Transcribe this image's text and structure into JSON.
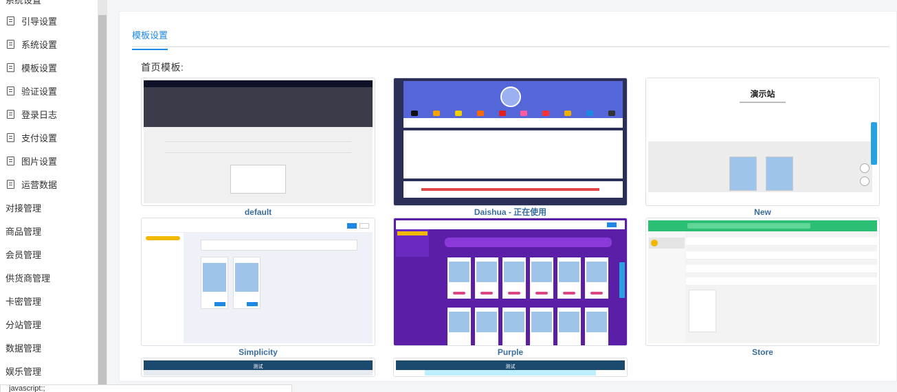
{
  "sidebar": {
    "header_fragment": "系统设置",
    "sub_items": [
      {
        "label": "引导设置",
        "icon": "document-icon"
      },
      {
        "label": "系统设置",
        "icon": "document-icon"
      },
      {
        "label": "模板设置",
        "icon": "document-icon"
      },
      {
        "label": "验证设置",
        "icon": "document-icon"
      },
      {
        "label": "登录日志",
        "icon": "document-icon"
      },
      {
        "label": "支付设置",
        "icon": "document-icon"
      },
      {
        "label": "图片设置",
        "icon": "document-icon"
      },
      {
        "label": "运营数据",
        "icon": "document-icon"
      }
    ],
    "top_items": [
      {
        "label": "对接管理"
      },
      {
        "label": "商品管理"
      },
      {
        "label": "会员管理"
      },
      {
        "label": "供货商管理"
      },
      {
        "label": "卡密管理"
      },
      {
        "label": "分站管理"
      },
      {
        "label": "数据管理"
      },
      {
        "label": "娱乐管理"
      }
    ]
  },
  "main": {
    "tab_label": "模板设置",
    "section_title": "首页模板:",
    "templates": [
      {
        "name": "default"
      },
      {
        "name": "Daishua - 正在使用"
      },
      {
        "name": "New",
        "thumb_title": "演示站"
      },
      {
        "name": "Simplicity"
      },
      {
        "name": "Purple"
      },
      {
        "name": "Store"
      },
      {
        "name": "",
        "thumb_title": "测试"
      },
      {
        "name": "",
        "thumb_title": "测试"
      }
    ]
  },
  "statusbar": {
    "text": "javascript:;"
  },
  "colors": {
    "accent": "#1e88e5",
    "template_name": "#3a6d9e",
    "sidebar_scroll_thumb": "#c1c1c1"
  }
}
